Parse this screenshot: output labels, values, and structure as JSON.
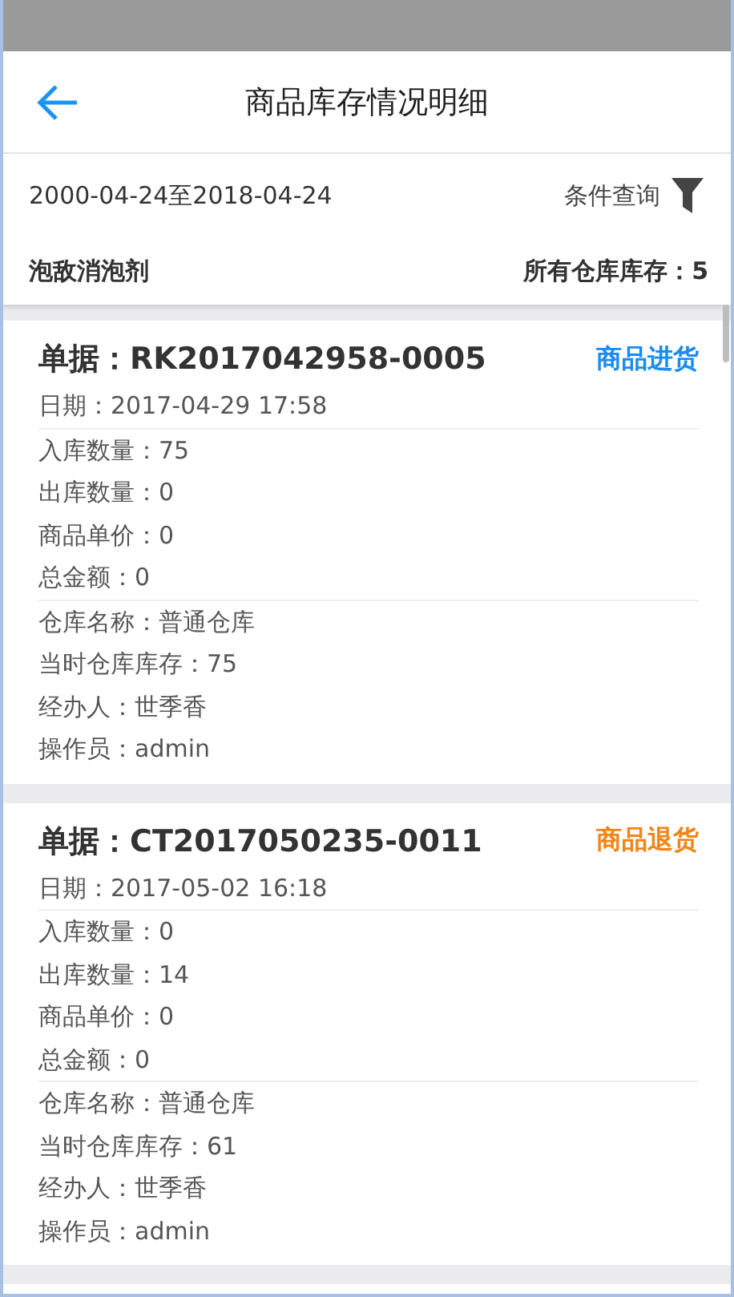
{
  "header": {
    "title": "商品库存情况明细"
  },
  "filter": {
    "date_range": "2000-04-24至2018-04-24",
    "query_label": "条件查询"
  },
  "summary": {
    "product": "泡敌消泡剂",
    "total_stock": "所有仓库库存：5"
  },
  "records": [
    {
      "document": "单据：RK2017042958-0005",
      "type": "商品进货",
      "color": "#1a8cf0",
      "date": "日期：2017-04-29 17:58",
      "groups": [
        [
          "入库数量：75",
          "出库数量：0",
          "商品单价：0",
          "总金额：0"
        ],
        [
          "仓库名称：普通仓库",
          "当时仓库库存：75",
          "经办人：世季香",
          "操作员：admin"
        ]
      ]
    },
    {
      "document": "单据：CT2017050235-0011",
      "type": "商品退货",
      "color": "#f0861a",
      "date": "日期：2017-05-02 16:18",
      "groups": [
        [
          "入库数量：0",
          "出库数量：14",
          "商品单价：0",
          "总金额：0"
        ],
        [
          "仓库名称：普通仓库",
          "当时仓库库存：61",
          "经办人：世季香",
          "操作员：admin"
        ]
      ]
    }
  ]
}
